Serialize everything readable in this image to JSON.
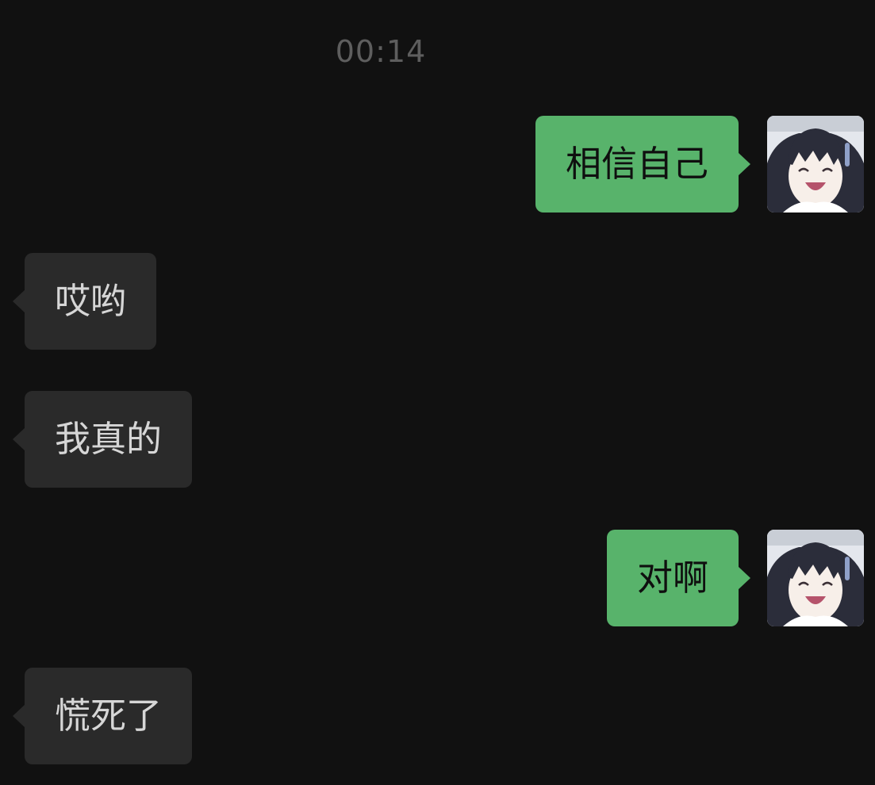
{
  "chat": {
    "timestamp": "00:14",
    "messages": [
      {
        "direction": "outgoing",
        "text": "相信自己",
        "has_avatar": true
      },
      {
        "direction": "incoming",
        "text": "哎哟"
      },
      {
        "direction": "incoming",
        "text": "我真的"
      },
      {
        "direction": "outgoing",
        "text": "对啊",
        "has_avatar": true
      },
      {
        "direction": "incoming",
        "text": "慌死了"
      }
    ]
  },
  "colors": {
    "background": "#111111",
    "outgoing_bubble": "#58b36b",
    "incoming_bubble": "#2a2a2a",
    "timestamp_text": "#5e5e5e"
  },
  "icons": {
    "avatar": "anime-girl-avatar-icon"
  }
}
